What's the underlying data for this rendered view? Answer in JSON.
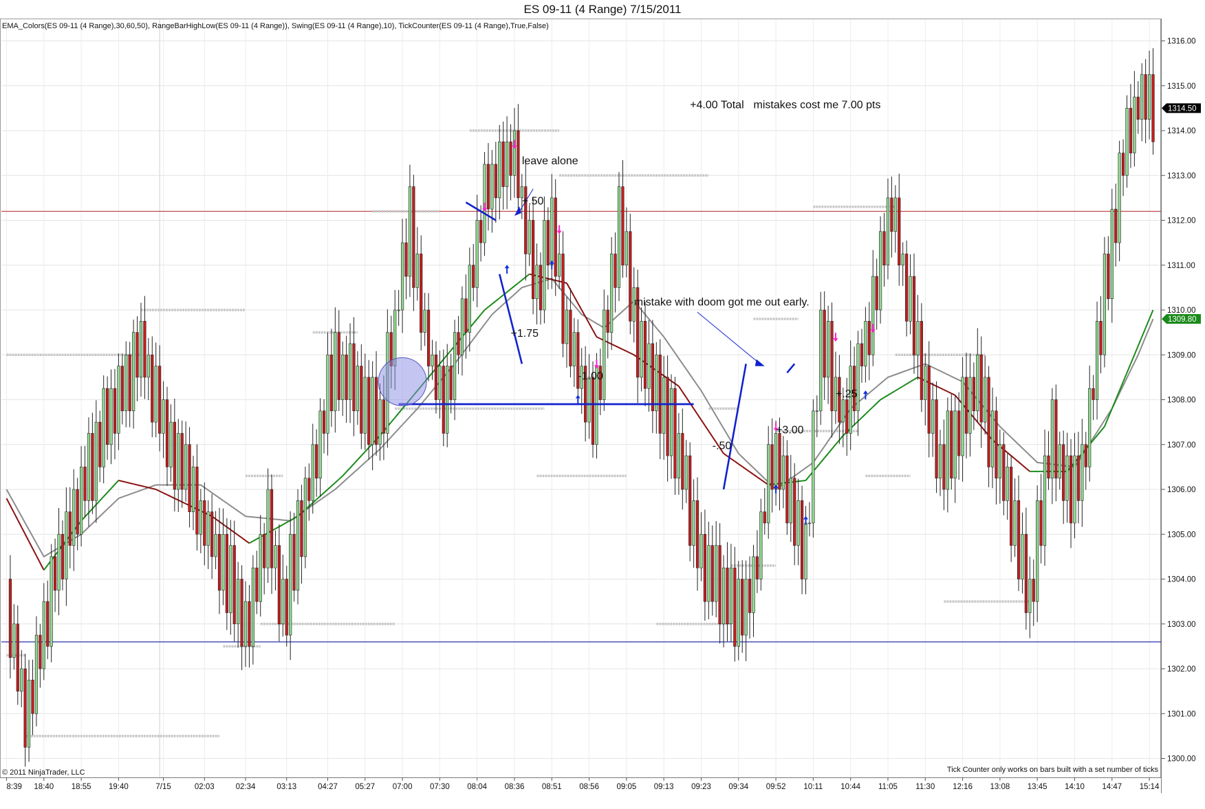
{
  "window": {
    "title": "ES 09-11 (4 Range)  7/15/2011"
  },
  "indicators_label": "EMA_Colors(ES 09-11 (4 Range),30,60,50), RangeBarHighLow(ES 09-11 (4 Range)), Swing(ES 09-11 (4 Range),10), TickCounter(ES 09-11 (4 Range),True,False)",
  "copyright": "© 2011 NinjaTrader, LLC",
  "tick_counter_note": "Tick Counter only works on bars built with a set number of ticks",
  "colors": {
    "up_bar": "#90d890",
    "down_bar": "#c41e1e",
    "ema_fast_up": "#1a8a1a",
    "ema_fast_down": "#8b1010",
    "ema_slow": "#8c8c8c",
    "swing_level": "#c8c8c8",
    "red_hline": "#c04040",
    "blue_hline": "#2233aa",
    "annotation": "#1122cc",
    "circle_fill": "#8c8ce6",
    "arrow_up": "#1133dd",
    "arrow_down": "#ff22cc",
    "price_tag_black": "#000000",
    "price_tag_green": "#1a8a1a"
  },
  "chart_data": {
    "type": "candlestick",
    "title": "ES 09-11 (4 Range)  7/15/2011",
    "instrument": "ES 09-11",
    "bar_type": "4 Range",
    "date": "7/15/2011",
    "ylim": [
      1300.0,
      1316.0
    ],
    "y_ticks": [
      "1300.00",
      "1301.00",
      "1302.00",
      "1303.00",
      "1304.00",
      "1305.00",
      "1306.00",
      "1307.00",
      "1308.00",
      "1309.00",
      "1310.00",
      "1311.00",
      "1312.00",
      "1313.00",
      "1314.00",
      "1315.00",
      "1316.00"
    ],
    "x_ticks": [
      {
        "bar": 0,
        "label": "8:39"
      },
      {
        "bar": 10,
        "label": "18:40"
      },
      {
        "bar": 20,
        "label": "18:55"
      },
      {
        "bar": 30,
        "label": "19:40"
      },
      {
        "bar": 42,
        "label": "7/15"
      },
      {
        "bar": 53,
        "label": "02:03"
      },
      {
        "bar": 64,
        "label": "02:34"
      },
      {
        "bar": 75,
        "label": "03:13"
      },
      {
        "bar": 86,
        "label": "04:27"
      },
      {
        "bar": 96,
        "label": "05:27"
      },
      {
        "bar": 106,
        "label": "07:00"
      },
      {
        "bar": 116,
        "label": "07:30"
      },
      {
        "bar": 126,
        "label": "08:04"
      },
      {
        "bar": 136,
        "label": "08:36"
      },
      {
        "bar": 146,
        "label": "08:51"
      },
      {
        "bar": 156,
        "label": "08:56"
      },
      {
        "bar": 166,
        "label": "09:05"
      },
      {
        "bar": 176,
        "label": "09:13"
      },
      {
        "bar": 186,
        "label": "09:23"
      },
      {
        "bar": 196,
        "label": "09:34"
      },
      {
        "bar": 206,
        "label": "09:52"
      },
      {
        "bar": 216,
        "label": "10:11"
      },
      {
        "bar": 226,
        "label": "10:44"
      },
      {
        "bar": 236,
        "label": "11:05"
      },
      {
        "bar": 246,
        "label": "11:30"
      },
      {
        "bar": 256,
        "label": "12:16"
      },
      {
        "bar": 266,
        "label": "13:08"
      },
      {
        "bar": 276,
        "label": "13:45"
      },
      {
        "bar": 286,
        "label": "14:10"
      },
      {
        "bar": 296,
        "label": "14:47"
      },
      {
        "bar": 306,
        "label": "15:14"
      }
    ],
    "path_pivots": [
      [
        0,
        1303.5
      ],
      [
        5,
        1301.0
      ],
      [
        12,
        1303.8
      ],
      [
        24,
        1307.0
      ],
      [
        36,
        1309.2
      ],
      [
        44,
        1307.0
      ],
      [
        54,
        1305.0
      ],
      [
        64,
        1303.0
      ],
      [
        70,
        1305.2
      ],
      [
        74,
        1303.3
      ],
      [
        82,
        1306.5
      ],
      [
        88,
        1309.0
      ],
      [
        100,
        1307.5
      ],
      [
        108,
        1312.0
      ],
      [
        114,
        1308.5
      ],
      [
        118,
        1307.9
      ],
      [
        128,
        1312.5
      ],
      [
        136,
        1313.5
      ],
      [
        142,
        1310.5
      ],
      [
        146,
        1312.0
      ],
      [
        150,
        1309.5
      ],
      [
        157,
        1307.5
      ],
      [
        164,
        1312.0
      ],
      [
        170,
        1309.0
      ],
      [
        178,
        1307.5
      ],
      [
        186,
        1304.3
      ],
      [
        198,
        1303.2
      ],
      [
        206,
        1307.0
      ],
      [
        214,
        1304.5
      ],
      [
        218,
        1309.5
      ],
      [
        224,
        1307.5
      ],
      [
        230,
        1309.3
      ],
      [
        237,
        1312.3
      ],
      [
        244,
        1309.0
      ],
      [
        250,
        1306.5
      ],
      [
        260,
        1308.5
      ],
      [
        274,
        1303.7
      ],
      [
        280,
        1307.3
      ],
      [
        284,
        1306.0
      ],
      [
        288,
        1306.4
      ],
      [
        294,
        1310.5
      ],
      [
        299,
        1313.5
      ],
      [
        304,
        1314.9
      ],
      [
        307,
        1314.6
      ]
    ],
    "series": [
      {
        "name": "EMA fast",
        "points": [
          [
            0,
            1305.8
          ],
          [
            10,
            1304.2
          ],
          [
            20,
            1305.3
          ],
          [
            30,
            1306.2
          ],
          [
            40,
            1306.0
          ],
          [
            55,
            1305.4
          ],
          [
            65,
            1304.8
          ],
          [
            78,
            1305.4
          ],
          [
            90,
            1306.3
          ],
          [
            100,
            1307.2
          ],
          [
            110,
            1308.2
          ],
          [
            118,
            1309.0
          ],
          [
            128,
            1310.0
          ],
          [
            140,
            1310.8
          ],
          [
            150,
            1310.6
          ],
          [
            158,
            1309.4
          ],
          [
            168,
            1309.0
          ],
          [
            180,
            1308.3
          ],
          [
            192,
            1306.8
          ],
          [
            204,
            1306.1
          ],
          [
            214,
            1306.2
          ],
          [
            224,
            1307.2
          ],
          [
            234,
            1308.0
          ],
          [
            244,
            1308.5
          ],
          [
            254,
            1308.1
          ],
          [
            264,
            1307.1
          ],
          [
            274,
            1306.4
          ],
          [
            284,
            1306.4
          ],
          [
            294,
            1307.4
          ],
          [
            302,
            1309.0
          ],
          [
            307,
            1310.0
          ]
        ]
      },
      {
        "name": "EMA slow",
        "points": [
          [
            0,
            1306.0
          ],
          [
            10,
            1304.5
          ],
          [
            20,
            1305.0
          ],
          [
            30,
            1305.8
          ],
          [
            40,
            1306.1
          ],
          [
            52,
            1306.1
          ],
          [
            64,
            1305.4
          ],
          [
            76,
            1305.3
          ],
          [
            88,
            1306.0
          ],
          [
            100,
            1306.9
          ],
          [
            110,
            1307.8
          ],
          [
            120,
            1308.8
          ],
          [
            130,
            1309.9
          ],
          [
            138,
            1310.5
          ],
          [
            146,
            1310.7
          ],
          [
            154,
            1309.9
          ],
          [
            160,
            1309.6
          ],
          [
            168,
            1310.2
          ],
          [
            176,
            1309.4
          ],
          [
            186,
            1308.2
          ],
          [
            196,
            1306.8
          ],
          [
            206,
            1306.0
          ],
          [
            216,
            1306.6
          ],
          [
            226,
            1307.8
          ],
          [
            236,
            1308.5
          ],
          [
            246,
            1308.8
          ],
          [
            256,
            1308.4
          ],
          [
            266,
            1307.4
          ],
          [
            276,
            1306.6
          ],
          [
            286,
            1306.5
          ],
          [
            296,
            1307.8
          ],
          [
            303,
            1309.0
          ],
          [
            307,
            1309.8
          ]
        ]
      }
    ],
    "swing_levels": [
      {
        "price": 1309.0,
        "from_bar": 0,
        "to_bar": 36
      },
      {
        "price": 1310.0,
        "from_bar": 36,
        "to_bar": 64
      },
      {
        "price": 1302.3,
        "from_bar": 0,
        "to_bar": 5
      },
      {
        "price": 1300.5,
        "from_bar": 5,
        "to_bar": 57
      },
      {
        "price": 1302.5,
        "from_bar": 58,
        "to_bar": 68
      },
      {
        "price": 1306.3,
        "from_bar": 64,
        "to_bar": 74
      },
      {
        "price": 1303.0,
        "from_bar": 68,
        "to_bar": 104
      },
      {
        "price": 1309.5,
        "from_bar": 82,
        "to_bar": 94
      },
      {
        "price": 1312.2,
        "from_bar": 98,
        "to_bar": 116
      },
      {
        "price": 1307.8,
        "from_bar": 104,
        "to_bar": 144
      },
      {
        "price": 1314.0,
        "from_bar": 124,
        "to_bar": 148
      },
      {
        "price": 1313.0,
        "from_bar": 148,
        "to_bar": 188
      },
      {
        "price": 1306.3,
        "from_bar": 142,
        "to_bar": 166
      },
      {
        "price": 1303.0,
        "from_bar": 174,
        "to_bar": 194
      },
      {
        "price": 1307.8,
        "from_bar": 188,
        "to_bar": 196
      },
      {
        "price": 1304.3,
        "from_bar": 194,
        "to_bar": 206
      },
      {
        "price": 1309.8,
        "from_bar": 200,
        "to_bar": 212
      },
      {
        "price": 1307.3,
        "from_bar": 206,
        "to_bar": 228
      },
      {
        "price": 1312.3,
        "from_bar": 216,
        "to_bar": 238
      },
      {
        "price": 1306.3,
        "from_bar": 230,
        "to_bar": 242
      },
      {
        "price": 1309.0,
        "from_bar": 238,
        "to_bar": 262
      },
      {
        "price": 1303.5,
        "from_bar": 251,
        "to_bar": 274
      }
    ],
    "horizontal_lines": [
      {
        "name": "red-level",
        "price": 1312.2
      },
      {
        "name": "blue-level",
        "price": 1302.6
      }
    ],
    "price_tags": [
      {
        "price": 1314.5,
        "label": "1314.50",
        "style": "black"
      },
      {
        "price": 1309.8,
        "label": "1309.80",
        "style": "green"
      }
    ]
  },
  "annotations": [
    {
      "id": "total",
      "text": "+4.00 Total",
      "bar": 183,
      "price": 1314.5
    },
    {
      "id": "mistakes-cost",
      "text": "mistakes cost  me 7.00 pts",
      "bar": 200,
      "price": 1314.5
    },
    {
      "id": "leave-alone",
      "text": "leave alone",
      "bar": 138,
      "price": 1313.25
    },
    {
      "id": "plus-50",
      "text": "+.50",
      "bar": 138,
      "price": 1312.35
    },
    {
      "id": "plus-175",
      "text": "+1.75",
      "bar": 135,
      "price": 1309.4
    },
    {
      "id": "minus-100",
      "text": "-1.00",
      "bar": 153,
      "price": 1308.45
    },
    {
      "id": "mistake-doom",
      "text": "mistake with doom got me out early.",
      "bar": 168,
      "price": 1310.1
    },
    {
      "id": "plus-25",
      "text": "+.25",
      "bar": 222,
      "price": 1308.05
    },
    {
      "id": "plus-300",
      "text": "+3.00",
      "bar": 206,
      "price": 1307.25
    },
    {
      "id": "minus-50",
      "text": "-.50",
      "bar": 189,
      "price": 1306.9
    }
  ]
}
